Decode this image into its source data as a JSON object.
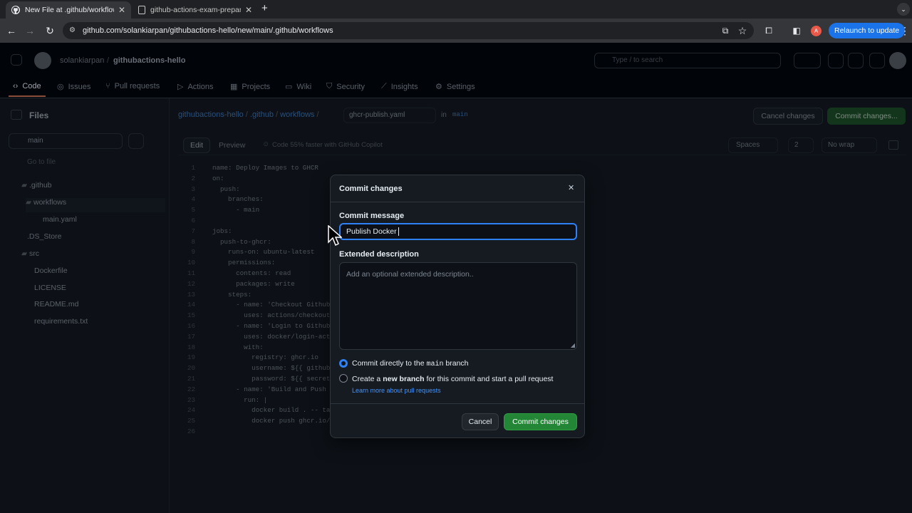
{
  "browser": {
    "tabs": [
      {
        "title": "New File at .github/workflows",
        "active": true
      },
      {
        "title": "github-actions-exam-preparatio",
        "active": false
      }
    ],
    "url": "github.com/solankiarpan/githubactions-hello/new/main/.github/workflows",
    "profile_initial": "A",
    "relaunch_label": "Relaunch to update"
  },
  "github": {
    "owner": "solankiarpan",
    "repo": "githubactions-hello",
    "search_placeholder": "Type / to search",
    "repo_nav": [
      "Code",
      "Issues",
      "Pull requests",
      "Actions",
      "Projects",
      "Wiki",
      "Security",
      "Insights",
      "Settings"
    ],
    "files_heading": "Files",
    "branch": "main",
    "go_to_file": "Go to file",
    "tree": [
      ".github",
      "workflows",
      "main.yaml",
      ".DS_Store",
      "src",
      "Dockerfile",
      "LICENSE",
      "README.md",
      "requirements.txt"
    ],
    "breadcrumb": {
      "repo": "githubactions-hello",
      "dir1": ".github",
      "dir2": "workflows",
      "filename": "ghcr-publish.yaml",
      "in_label": "in",
      "branch": "main"
    },
    "cancel_changes": "Cancel changes",
    "commit_changes_top": "Commit changes...",
    "editor_tabs": {
      "edit": "Edit",
      "preview": "Preview",
      "copilot": "Code 55% faster with GitHub Copilot"
    },
    "editor_options": {
      "indent": "Spaces",
      "size": "2",
      "wrap": "No wrap"
    },
    "code_lines": [
      "name: Deploy Images to GHCR",
      "on:",
      "  push:",
      "    branches:",
      "      - main",
      "",
      "jobs:",
      "  push-to-ghcr:",
      "    runs-on: ubuntu-latest",
      "    permissions:",
      "      contents: read",
      "      packages: write",
      "    steps:",
      "      - name: 'Checkout Github",
      "        uses: actions/checkout@",
      "      - name: 'Login to Github",
      "        uses: docker/login-acti",
      "        with:",
      "          registry: ghcr.io",
      "          username: ${{ github.",
      "          password: ${{ secrets",
      "      - name: 'Build and Push t",
      "        run: |",
      "          docker build . -- tag",
      "          docker push ghcr.io/",
      ""
    ]
  },
  "modal": {
    "title": "Commit changes",
    "commit_message_label": "Commit message",
    "commit_message_value": "Publish Docker",
    "extended_label": "Extended description",
    "extended_placeholder": "Add an optional extended description..",
    "option1_pre": "Commit directly to the",
    "option1_branch": "main",
    "option1_post": "branch",
    "option2_pre": "Create a",
    "option2_bold": "new branch",
    "option2_post": "for this commit and start a pull request",
    "learn_more": "Learn more about pull requests",
    "cancel": "Cancel",
    "commit": "Commit changes"
  },
  "colors": {
    "accent": "#2f81f7",
    "commit_green": "#238636"
  }
}
